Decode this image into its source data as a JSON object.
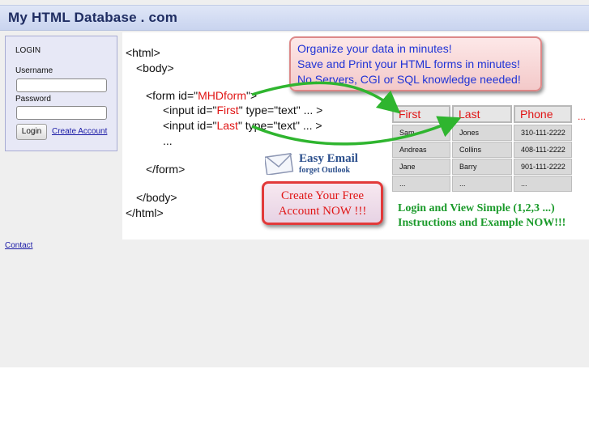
{
  "header": {
    "title": "My HTML Database . com"
  },
  "login": {
    "title": "LOGIN",
    "username_label": "Username",
    "password_label": "Password",
    "login_button": "Login",
    "create_account_link": "Create Account"
  },
  "footer": {
    "contact_link": "Contact"
  },
  "banner": {
    "code_lines": [
      "<html>",
      "<body>",
      "<form id=\"",
      "MHDform",
      "\">",
      "<input id=\"",
      "First",
      "\" type=\"text\" ... >",
      "<input id=\"",
      "Last",
      "\" type=\"text\" ... >",
      "...",
      "</form>",
      "</body>",
      "</html>"
    ],
    "promo": [
      "Organize your data in minutes!",
      "Save and Print your HTML forms in minutes!",
      "No Servers, CGI or SQL knowledge needed!"
    ],
    "table": {
      "headers": [
        "First",
        "Last",
        "Phone"
      ],
      "rows": [
        [
          "Sam",
          "Jones",
          "310-111-2222"
        ],
        [
          "Andreas",
          "Collins",
          "408-111-2222"
        ],
        [
          "Jane",
          "Barry",
          "901-111-2222"
        ],
        [
          "...",
          "...",
          "..."
        ]
      ],
      "more": "..."
    },
    "email": {
      "title": "Easy Email",
      "subtitle": "forget Outlook"
    },
    "cta": [
      "Create Your Free",
      "Account NOW !!!"
    ],
    "instructions": [
      "Login and View Simple (1,2,3 ...)",
      "Instructions and Example NOW!!!"
    ]
  }
}
